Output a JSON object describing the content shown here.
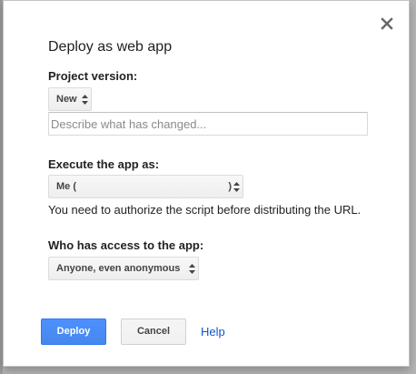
{
  "dialog": {
    "title": "Deploy as web app",
    "project_version": {
      "label": "Project version:",
      "selected": "New",
      "change_placeholder": "Describe what has changed..."
    },
    "execute_as": {
      "label": "Execute the app as:",
      "selected_prefix": "Me (",
      "selected_suffix": ")",
      "note": "You need to authorize the script before distributing the URL."
    },
    "access": {
      "label": "Who has access to the app:",
      "selected": "Anyone, even anonymous"
    },
    "buttons": {
      "deploy": "Deploy",
      "cancel": "Cancel",
      "help": "Help"
    }
  },
  "colors": {
    "primary_button": "#4d90fe",
    "link": "#1155cc",
    "backdrop": "#b5b5b5"
  },
  "icons": {
    "close": "close-icon",
    "select_arrows": "select-arrows-icon"
  }
}
